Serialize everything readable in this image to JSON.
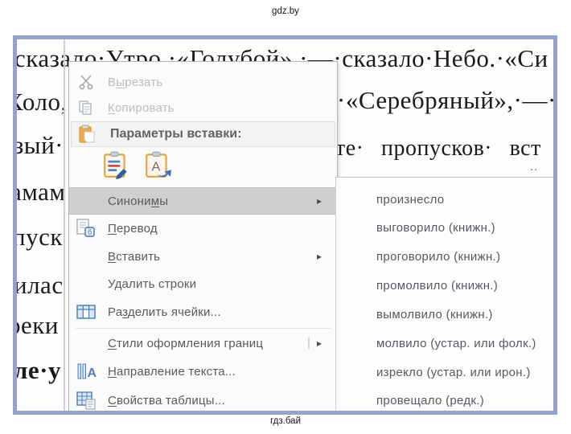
{
  "captions": {
    "top": "gdz.by",
    "bottom": "гдз.бай"
  },
  "doc": {
    "line1": "сказало·Утро.·«Голубой»,·—·сказало·Небо.·«Си",
    "line2_left": "Холо,",
    "line2_right": "·«Серебряный»,·—·с",
    "line3_left": "зый·",
    "line3_right": "те·  пропусков·  вст",
    "line4_left": "амам",
    "line5_left": "пуск",
    "line6_left": "илас",
    "line7_left": "реки",
    "line8_left": "ле·у",
    "dots_fragment": ".."
  },
  "menu": {
    "cut": {
      "pre": "В",
      "accel": "ы",
      "post": "резать"
    },
    "copy": {
      "pre": "",
      "accel": "К",
      "post": "опировать"
    },
    "paste_options": {
      "label": "Параметры вставки:"
    },
    "synonyms": {
      "pre": "Синони",
      "accel": "м",
      "post": "ы"
    },
    "translate": {
      "pre": "",
      "accel": "П",
      "post": "еревод"
    },
    "insert": {
      "pre": "",
      "accel": "В",
      "post": "ставить"
    },
    "delete_rows": {
      "pre": "У",
      "accel": "д",
      "post": "алить строки"
    },
    "split_cells": {
      "pre": "Ра",
      "accel": "з",
      "post": "делить ячейки..."
    },
    "border_styles": {
      "pre": "",
      "accel": "С",
      "post": "тили оформления границ"
    },
    "text_direction": {
      "pre": "",
      "accel": "Н",
      "post": "аправление текста..."
    },
    "table_properties": {
      "pre": "",
      "accel": "С",
      "post": "войства таблицы..."
    }
  },
  "submenu": {
    "items": [
      "произнесло",
      "выговорило (книжн.)",
      "проговорило (книжн.)",
      "промолвило (книжн.)",
      "вымолвило (книжн.)",
      "молвило (устар. или фолк.)",
      "изрекло (устар. или ирон.)",
      "провещало (редк.)"
    ]
  },
  "glyphs": {
    "submenu_arrow": "▸",
    "divider": "|"
  },
  "icons": {
    "cut": "scissors-icon",
    "copy": "copy-pages-icon",
    "paste_options": "clipboard-icon",
    "paste_keep_formatting": "paste-keep-formatting-icon",
    "paste_text_only": "paste-text-only-icon",
    "translate": "translate-icon",
    "split_cells": "split-cells-icon",
    "text_direction": "text-direction-icon",
    "table_properties": "table-properties-icon"
  },
  "colors": {
    "frame_border": "#95a2cc",
    "menu_highlight": "#d0cfcf",
    "accent_orange": "#e0a33e",
    "accent_blue": "#4f81bd"
  }
}
